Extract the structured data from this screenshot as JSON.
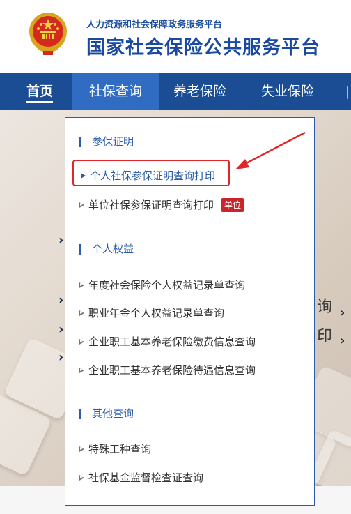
{
  "header": {
    "subtitle": "人力资源和社会保障政务服务平台",
    "title": "国家社会保险公共服务平台"
  },
  "nav": {
    "items": [
      {
        "label": "首页"
      },
      {
        "label": "社保查询"
      },
      {
        "label": "养老保险"
      },
      {
        "label": "失业保险"
      }
    ]
  },
  "banner": {
    "fragments": [
      "询",
      "印"
    ]
  },
  "dropdown": {
    "sections": [
      {
        "title": "参保证明",
        "items": [
          {
            "label": "个人社保参保证明查询打印"
          },
          {
            "label": "单位社保参保证明查询打印",
            "badge": "单位"
          }
        ]
      },
      {
        "title": "个人权益",
        "items": [
          {
            "label": "年度社会保险个人权益记录单查询"
          },
          {
            "label": "职业年金个人权益记录单查询"
          },
          {
            "label": "企业职工基本养老保险缴费信息查询"
          },
          {
            "label": "企业职工基本养老保险待遇信息查询"
          }
        ]
      },
      {
        "title": "其他查询",
        "items": [
          {
            "label": "特殊工种查询"
          },
          {
            "label": "社保基金监督检查证查询"
          }
        ]
      }
    ]
  },
  "colors": {
    "brand_blue": "#1b4d94",
    "active_tab": "#2f6cc2",
    "highlight_red": "#e0262a",
    "badge_red": "#c9262c"
  }
}
